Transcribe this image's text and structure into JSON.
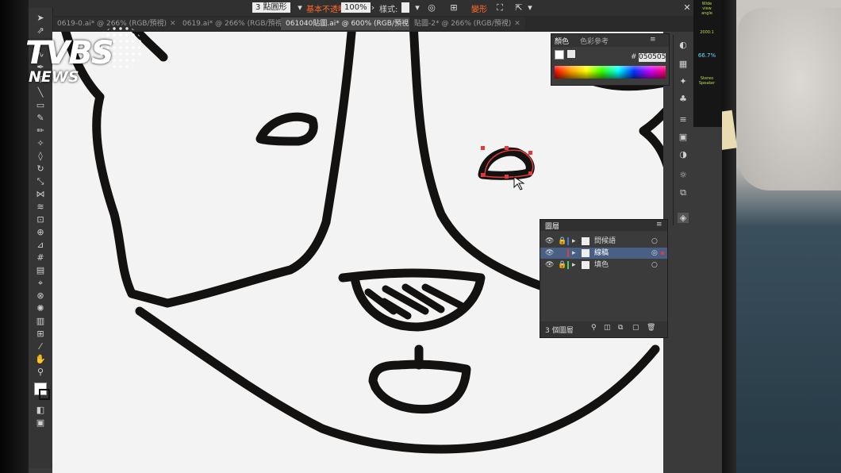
{
  "watermark": {
    "line1": "TVBS",
    "line2": "NEWS"
  },
  "options_bar": {
    "shape_value": "3 點圓形",
    "basic_label": "基本",
    "opacity_label": "不透明度",
    "zoom_value": "100%",
    "style_label": "樣式:",
    "shape_label": "變形"
  },
  "doc_tabs": [
    {
      "label": "0619-0.ai* @ 266% (RGB/預視)",
      "active": false
    },
    {
      "label": "0619.ai* @ 266% (RGB/預視)",
      "active": false
    },
    {
      "label": "061040貼圖.ai* @ 600% (RGB/預視)",
      "active": true
    },
    {
      "label": "貼圖-2* @ 266% (RGB/預視)",
      "active": false
    }
  ],
  "color_panel": {
    "tabs": [
      "顏色",
      "色彩參考"
    ],
    "hash": "#",
    "hex": "050505"
  },
  "layers_panel": {
    "title": "圖層",
    "layers": [
      {
        "name": "問候語",
        "color": "#3f7bd8",
        "selected": false
      },
      {
        "name": "線稿",
        "color": "#d83f3f",
        "selected": true
      },
      {
        "name": "填色",
        "color": "#3fd85a",
        "selected": false
      }
    ],
    "count": "3 個圖層"
  },
  "side_widget": {
    "items": [
      "Wide view angle",
      "2000:1",
      "66.7%",
      "Stereo Speaker"
    ]
  }
}
